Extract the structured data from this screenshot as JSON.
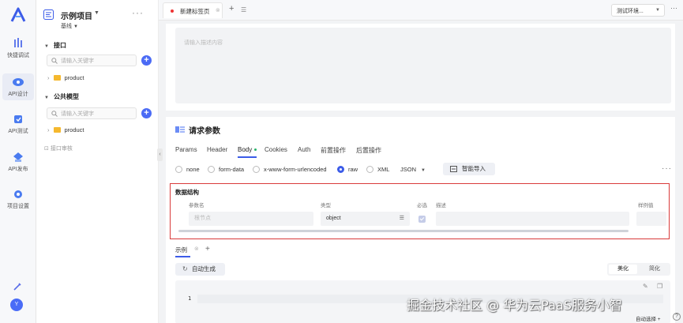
{
  "rail": {
    "items": [
      {
        "label": "快捷调试",
        "icon": "quick-debug-icon"
      },
      {
        "label": "API设计",
        "icon": "api-design-icon"
      },
      {
        "label": "API测试",
        "icon": "api-test-icon"
      },
      {
        "label": "API发布",
        "icon": "api-publish-icon"
      },
      {
        "label": "项目设置",
        "icon": "project-settings-icon"
      }
    ],
    "avatar": "Y"
  },
  "sidebar": {
    "project_title": "示例项目",
    "branch": "基线",
    "sections": [
      {
        "title": "接口",
        "search_placeholder": "请输入关键字",
        "tree": [
          "product"
        ]
      },
      {
        "title": "公共模型",
        "search_placeholder": "请输入关键字",
        "tree": [
          "product"
        ]
      }
    ],
    "docs_item": "接口审核"
  },
  "tabbar": {
    "tab_label": "新建标签页",
    "env_select": "测试环境..."
  },
  "description": {
    "placeholder": "请输入描述内容"
  },
  "request": {
    "title": "请求参数",
    "tabs": [
      "Params",
      "Header",
      "Body",
      "Cookies",
      "Auth",
      "前置操作",
      "后置操作"
    ],
    "active_tab": "Body",
    "body_types": [
      "none",
      "form-data",
      "x-www-form-urlencoded",
      "raw",
      "XML"
    ],
    "selected_body_type": "raw",
    "format": "JSON",
    "smart_import": "智能导入"
  },
  "data_structure": {
    "title": "数据结构",
    "columns": [
      "参数名",
      "类型",
      "必选",
      "描述",
      "样例值"
    ],
    "row": {
      "name_placeholder": "根节点",
      "type": "object",
      "required": true
    }
  },
  "example": {
    "tab_label": "示例",
    "auto_generate": "自动生成",
    "beautify": "美化",
    "simplify": "简化",
    "line_number": "1"
  },
  "watermark": "掘金技术社区 @ 华为云PaaS服务小智",
  "footer": {
    "auto_select": "自动选择 +",
    "help": "?"
  },
  "colors": {
    "primary": "#3c5ce8",
    "highlight_border": "#d93a3a",
    "tab_dot": "#ee3333",
    "body_dot": "#28b26a",
    "folder": "#f5b82e"
  }
}
